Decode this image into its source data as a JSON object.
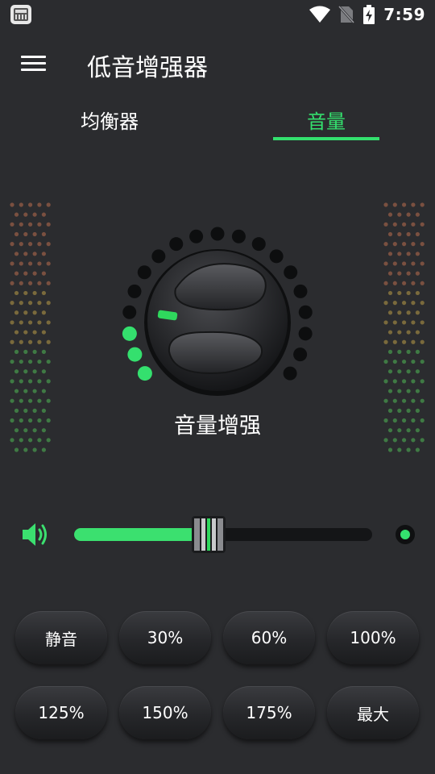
{
  "status_bar": {
    "time": "7:59",
    "icons": [
      "app-notification-icon",
      "wifi-icon",
      "no-sim-icon",
      "battery-charging-icon"
    ]
  },
  "toolbar": {
    "title": "低音增强器",
    "menu_icon": "hamburger-menu-icon"
  },
  "tabs": [
    {
      "label": "均衡器",
      "active": false
    },
    {
      "label": "音量",
      "active": true
    }
  ],
  "knob": {
    "label": "音量增强",
    "active_dots": 3,
    "total_dots": 19,
    "accent": "#34e06e"
  },
  "volume": {
    "icon": "speaker-icon",
    "level": 0.45,
    "end_icon": "indicator-dot-icon"
  },
  "presets": [
    {
      "label": "静音"
    },
    {
      "label": "30%"
    },
    {
      "label": "60%"
    },
    {
      "label": "100%"
    },
    {
      "label": "125%"
    },
    {
      "label": "150%"
    },
    {
      "label": "175%"
    },
    {
      "label": "最大"
    }
  ],
  "colors": {
    "background": "#2b2c2f",
    "accent": "#34e06e",
    "track": "#141517"
  }
}
